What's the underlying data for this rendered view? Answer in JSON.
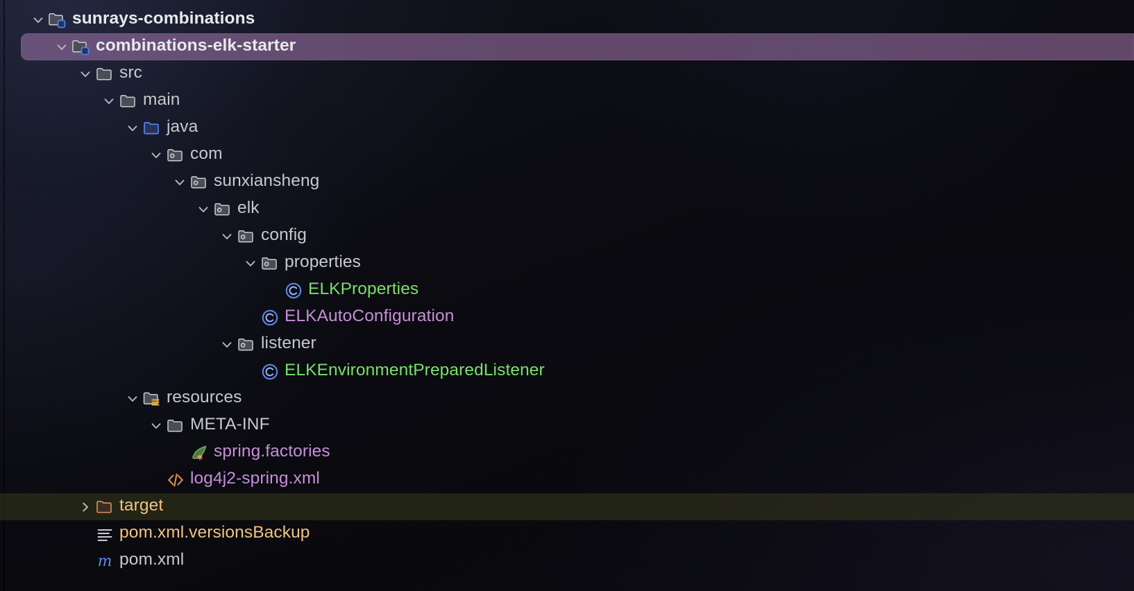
{
  "theme": {
    "background": "#0c0c13",
    "selection_background": "#966ea0",
    "ignored_row_background": "#464a1e",
    "text_default": "#c8c9cd",
    "text_added_vcs": "#79e06a",
    "text_modified_vcs": "#c58fd8",
    "text_ignored": "#f0c381",
    "accent_blue": "#5f87e8",
    "accent_orange": "#cf8e52"
  },
  "tree": {
    "name": "project-tool-window-tree",
    "rows": [
      {
        "id": "sunrays-combinations",
        "label": "sunrays-combinations",
        "depth": 0,
        "arrow": "chevron-down",
        "icon": "module-folder-icon",
        "style": "bold-white",
        "selected": false,
        "ignored": false
      },
      {
        "id": "combinations-elk-starter",
        "label": "combinations-elk-starter",
        "depth": 1,
        "arrow": "chevron-down",
        "icon": "module-folder-icon",
        "style": "bold-white",
        "selected": true,
        "ignored": false
      },
      {
        "id": "src",
        "label": "src",
        "depth": 2,
        "arrow": "chevron-down",
        "icon": "folder-icon",
        "style": "default",
        "selected": false,
        "ignored": false
      },
      {
        "id": "main",
        "label": "main",
        "depth": 3,
        "arrow": "chevron-down",
        "icon": "folder-icon",
        "style": "default",
        "selected": false,
        "ignored": false
      },
      {
        "id": "java",
        "label": "java",
        "depth": 4,
        "arrow": "chevron-down",
        "icon": "source-root-folder-icon",
        "style": "default",
        "selected": false,
        "ignored": false
      },
      {
        "id": "com",
        "label": "com",
        "depth": 5,
        "arrow": "chevron-down",
        "icon": "package-folder-icon",
        "style": "default",
        "selected": false,
        "ignored": false
      },
      {
        "id": "sunxiansheng",
        "label": "sunxiansheng",
        "depth": 6,
        "arrow": "chevron-down",
        "icon": "package-folder-icon",
        "style": "default",
        "selected": false,
        "ignored": false
      },
      {
        "id": "elk",
        "label": "elk",
        "depth": 7,
        "arrow": "chevron-down",
        "icon": "package-folder-icon",
        "style": "default",
        "selected": false,
        "ignored": false
      },
      {
        "id": "config",
        "label": "config",
        "depth": 8,
        "arrow": "chevron-down",
        "icon": "package-folder-icon",
        "style": "default",
        "selected": false,
        "ignored": false
      },
      {
        "id": "properties",
        "label": "properties",
        "depth": 9,
        "arrow": "chevron-down",
        "icon": "package-folder-icon",
        "style": "default",
        "selected": false,
        "ignored": false
      },
      {
        "id": "ELKProperties",
        "label": "ELKProperties",
        "depth": 10,
        "arrow": "none",
        "icon": "java-class-icon",
        "style": "added",
        "selected": false,
        "ignored": false
      },
      {
        "id": "ELKAutoConfiguration",
        "label": "ELKAutoConfiguration",
        "depth": 9,
        "arrow": "none",
        "icon": "java-class-icon",
        "style": "modified",
        "selected": false,
        "ignored": false
      },
      {
        "id": "listener",
        "label": "listener",
        "depth": 8,
        "arrow": "chevron-down",
        "icon": "package-folder-icon",
        "style": "default",
        "selected": false,
        "ignored": false
      },
      {
        "id": "ELKEnvironmentPreparedListener",
        "label": "ELKEnvironmentPreparedListener",
        "depth": 9,
        "arrow": "none",
        "icon": "java-class-icon",
        "style": "added",
        "selected": false,
        "ignored": false
      },
      {
        "id": "resources",
        "label": "resources",
        "depth": 4,
        "arrow": "chevron-down",
        "icon": "resources-root-folder-icon",
        "style": "default",
        "selected": false,
        "ignored": false
      },
      {
        "id": "META-INF",
        "label": "META-INF",
        "depth": 5,
        "arrow": "chevron-down",
        "icon": "folder-icon",
        "style": "default",
        "selected": false,
        "ignored": false
      },
      {
        "id": "spring.factories",
        "label": "spring.factories",
        "depth": 6,
        "arrow": "none",
        "icon": "spring-leaf-icon",
        "style": "modified",
        "selected": false,
        "ignored": false
      },
      {
        "id": "log4j2-spring.xml",
        "label": "log4j2-spring.xml",
        "depth": 5,
        "arrow": "none",
        "icon": "xml-file-icon",
        "style": "modified",
        "selected": false,
        "ignored": false
      },
      {
        "id": "target",
        "label": "target",
        "depth": 2,
        "arrow": "chevron-right",
        "icon": "excluded-folder-icon",
        "style": "ignored",
        "selected": false,
        "ignored": true
      },
      {
        "id": "pom.xml.versionsBackup",
        "label": "pom.xml.versionsBackup",
        "depth": 2,
        "arrow": "none",
        "icon": "text-file-icon",
        "style": "ignored",
        "selected": false,
        "ignored": false
      },
      {
        "id": "pom.xml",
        "label": "pom.xml",
        "depth": 2,
        "arrow": "none",
        "icon": "maven-pom-icon",
        "style": "default",
        "selected": false,
        "ignored": false
      }
    ]
  }
}
